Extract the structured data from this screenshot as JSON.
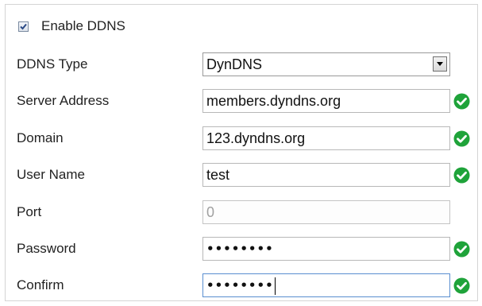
{
  "ddns": {
    "enable": {
      "label": "Enable DDNS",
      "checked": true
    },
    "type": {
      "label": "DDNS Type",
      "value": "DynDNS"
    },
    "server_address": {
      "label": "Server Address",
      "value": "members.dyndns.org",
      "status_icon": "check-circle-icon"
    },
    "domain": {
      "label": "Domain",
      "value": "123.dyndns.org",
      "status_icon": "check-circle-icon"
    },
    "user_name": {
      "label": "User Name",
      "value": "test",
      "status_icon": "check-circle-icon"
    },
    "port": {
      "label": "Port",
      "value": "0",
      "disabled": true
    },
    "password": {
      "label": "Password",
      "masked_value": "••••••••",
      "status_icon": "check-circle-icon"
    },
    "confirm": {
      "label": "Confirm",
      "masked_value": "••••••••",
      "status_icon": "check-circle-icon"
    }
  },
  "colors": {
    "ok_green": "#1fa33a",
    "field_border": "#b8b8b8",
    "focus_border": "#5a8ed0",
    "panel_border": "#d4d4d4"
  }
}
